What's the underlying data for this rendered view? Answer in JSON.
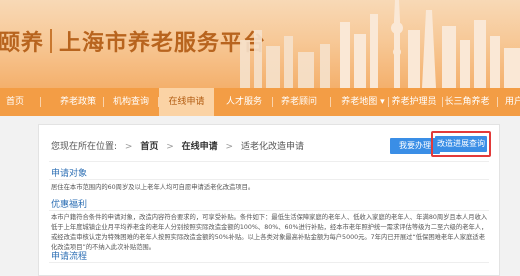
{
  "banner": {
    "brand_mark": "颐养",
    "title": "上海市养老服务平台"
  },
  "nav": {
    "items": [
      "首页",
      "养老政策",
      "机构查询",
      "在线申请",
      "人才服务",
      "养老顾问",
      "养老地图 ▾",
      "养老护理员",
      "长三角养老",
      "用户"
    ],
    "active_index": 3
  },
  "breadcrumb": {
    "prefix": "您现在所在位置:",
    "home": "首页",
    "section": "在线申请",
    "current": "适老化改造申请"
  },
  "buttons": {
    "handle": "我要办理",
    "progress_query": "改造进展查询"
  },
  "sections": {
    "target_title": "申请对象",
    "target_text": "居住在本市范围内的60周岁及以上老年人均可自愿申请适老化改造项目。",
    "benefit_title": "优惠福利",
    "benefit_text": "本市户籍符合条件的申请对象，改造内容符合要求的，可享受补贴。条件如下：最低生活保障家庭的老年人、低收入家庭的老年人、年满80周岁且本人月收入低于上年度城镇企业月平均养老金的老年人分别按照实际改造金额的100%、80%、60%进行补贴，经本市老年照护统一需求评估等级为二至六级的老年人，或经改造审核认定为特殊困难的老年人按照实际改造金额的50%补贴。以上各类对象最高补贴金额为每户5000元。7年内已开展过“低保困难老年人家庭适老化改造项目”的不纳入此次补贴范围。",
    "process_title": "申请流程"
  }
}
